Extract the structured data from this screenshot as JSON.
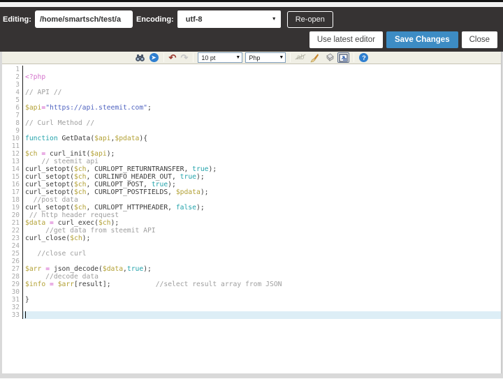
{
  "header": {
    "editing_label": "Editing:",
    "file_path": "/home/smartsch/test/a",
    "encoding_label": "Encoding:",
    "encoding_value": "utf-8",
    "reopen_button": "Re-open",
    "use_latest_button": "Use latest editor",
    "save_button": "Save Changes",
    "close_button": "Close"
  },
  "colors": {
    "header_bg": "#363333",
    "save_button_blue": "#3d8cc4",
    "toolbar_bg": "#f0efe5",
    "active_line_bg": "#ddeef6",
    "string_blue": "#4f63c0",
    "variable_yellow": "#b3a135",
    "keyword_teal": "#23a3ab",
    "operator_magenta": "#cf4dc4",
    "comment_gray": "#9e9e9e"
  },
  "toolbar": {
    "font_size_value": "10 pt",
    "language_value": "Php",
    "dropdown_arrow": "▼",
    "icons": {
      "find": "binoculars",
      "goto": "➤",
      "undo": "↶",
      "redo": "↷",
      "spellcheck_disabled": "ab",
      "highlight_brush": "brush",
      "eraser": "eraser",
      "popout_window": "window",
      "help": "?"
    }
  },
  "editor": {
    "active_line": 33,
    "lines": [
      [],
      [
        [
          "tg",
          "<?php"
        ]
      ],
      [],
      [
        [
          "cm",
          "// API //"
        ]
      ],
      [],
      [
        [
          "vr",
          "$api"
        ],
        [
          "op",
          "="
        ],
        [
          "st",
          "\"https://api.steemit.com\""
        ],
        [
          "pl",
          ";"
        ]
      ],
      [],
      [
        [
          "cm",
          "// Curl Method //"
        ]
      ],
      [],
      [
        [
          "kw",
          "function"
        ],
        [
          "pl",
          " GetData("
        ],
        [
          "vr",
          "$api"
        ],
        [
          "pl",
          ","
        ],
        [
          "vr",
          "$pdata"
        ],
        [
          "pl",
          "){"
        ]
      ],
      [],
      [
        [
          "vr",
          "$ch"
        ],
        [
          "pl",
          " "
        ],
        [
          "op",
          "="
        ],
        [
          "pl",
          " curl_init("
        ],
        [
          "vr",
          "$api"
        ],
        [
          "pl",
          ");"
        ]
      ],
      [
        [
          "cm",
          "    // steemit api"
        ]
      ],
      [
        [
          "pl",
          "curl_setopt("
        ],
        [
          "vr",
          "$ch"
        ],
        [
          "pl",
          ", CURLOPT_RETURNTRANSFER, "
        ],
        [
          "kw",
          "true"
        ],
        [
          "pl",
          ");"
        ]
      ],
      [
        [
          "pl",
          "curl_setopt("
        ],
        [
          "vr",
          "$ch"
        ],
        [
          "pl",
          ", CURLINFO_HEADER_OUT, "
        ],
        [
          "kw",
          "true"
        ],
        [
          "pl",
          ");"
        ]
      ],
      [
        [
          "pl",
          "curl_setopt("
        ],
        [
          "vr",
          "$ch"
        ],
        [
          "pl",
          ", CURLOPT_POST, "
        ],
        [
          "kw",
          "true"
        ],
        [
          "pl",
          ");"
        ]
      ],
      [
        [
          "pl",
          "curl_setopt("
        ],
        [
          "vr",
          "$ch"
        ],
        [
          "pl",
          ", CURLOPT_POSTFIELDS, "
        ],
        [
          "vr",
          "$pdata"
        ],
        [
          "pl",
          ");"
        ]
      ],
      [
        [
          "cm",
          "  //post data"
        ]
      ],
      [
        [
          "pl",
          "curl_setopt("
        ],
        [
          "vr",
          "$ch"
        ],
        [
          "pl",
          ", CURLOPT_HTTPHEADER, "
        ],
        [
          "kw",
          "false"
        ],
        [
          "pl",
          ");"
        ]
      ],
      [
        [
          "cm",
          " // http header request"
        ]
      ],
      [
        [
          "vr",
          "$data"
        ],
        [
          "pl",
          " "
        ],
        [
          "op",
          "="
        ],
        [
          "pl",
          " curl_exec("
        ],
        [
          "vr",
          "$ch"
        ],
        [
          "pl",
          ");"
        ]
      ],
      [
        [
          "cm",
          "     //get data from steemit API"
        ]
      ],
      [
        [
          "pl",
          "curl_close("
        ],
        [
          "vr",
          "$ch"
        ],
        [
          "pl",
          ");"
        ]
      ],
      [],
      [
        [
          "cm",
          "   //close curl"
        ]
      ],
      [],
      [
        [
          "vr",
          "$arr"
        ],
        [
          "pl",
          " "
        ],
        [
          "op",
          "="
        ],
        [
          "pl",
          " json_decode("
        ],
        [
          "vr",
          "$data"
        ],
        [
          "pl",
          ","
        ],
        [
          "kw",
          "true"
        ],
        [
          "pl",
          ");"
        ]
      ],
      [
        [
          "cm",
          "     //decode data"
        ]
      ],
      [
        [
          "vr",
          "$info"
        ],
        [
          "pl",
          " "
        ],
        [
          "op",
          "="
        ],
        [
          "pl",
          " "
        ],
        [
          "vr",
          "$arr"
        ],
        [
          "pl",
          "[result];           "
        ],
        [
          "cm",
          "//select result array from JSON"
        ]
      ],
      [],
      [
        [
          "pl",
          "}"
        ]
      ],
      [],
      []
    ]
  }
}
